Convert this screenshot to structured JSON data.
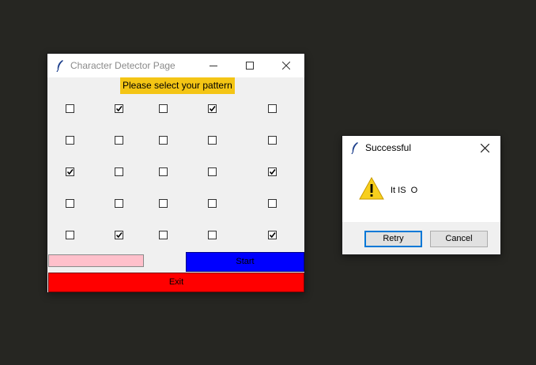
{
  "main_window": {
    "title": "Character Detector Page",
    "pattern_label": "Please select your pattern",
    "grid": [
      [
        false,
        true,
        false,
        true,
        false
      ],
      [
        false,
        false,
        false,
        false,
        false
      ],
      [
        true,
        false,
        false,
        false,
        true
      ],
      [
        false,
        false,
        false,
        false,
        false
      ],
      [
        false,
        true,
        false,
        false,
        true
      ]
    ],
    "name_input": {
      "value": ""
    },
    "start_label": "Start",
    "exit_label": "Exit",
    "colors": {
      "label_bg": "#f4c515",
      "input_bg": "#ffc0cb",
      "start_bg": "#0000ff",
      "exit_bg": "#ff0000"
    }
  },
  "dialog": {
    "title": "Successful",
    "message": "It IS  O",
    "icon": "warning-icon",
    "retry_label": "Retry",
    "cancel_label": "Cancel"
  }
}
